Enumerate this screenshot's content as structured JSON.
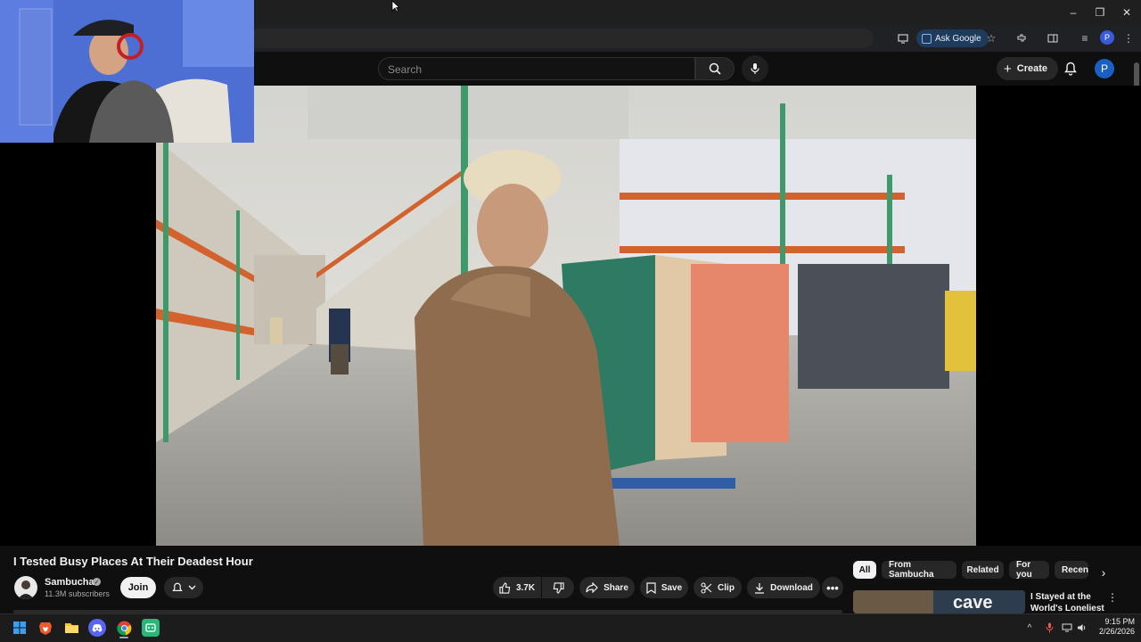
{
  "browser": {
    "ask_google_label": "Ask Google",
    "profile_initial": "P",
    "window_controls": {
      "minimize": "–",
      "restore": "❐",
      "close": "✕"
    }
  },
  "youtube": {
    "search": {
      "placeholder": "Search",
      "value": ""
    },
    "create_label": "Create",
    "avatar_initial": "P"
  },
  "video": {
    "title": "I Tested Busy Places At Their Deadest Hour",
    "channel": {
      "name": "Sambucha",
      "subscribers": "11.3M subscribers",
      "join_label": "Join"
    },
    "actions": {
      "likes": "3.7K",
      "share": "Share",
      "save": "Save",
      "clip": "Clip",
      "download": "Download"
    }
  },
  "recommendations": {
    "chips": [
      "All",
      "From Sambucha",
      "Related",
      "For you",
      "Recen"
    ],
    "first_item": {
      "title": "I Stayed at the World's Loneliest ...",
      "thumbnail_text": "cave"
    }
  },
  "taskbar": {
    "time": "9:15 PM",
    "date": "2/26/2026"
  },
  "colors": {
    "background": "#0f0f0f",
    "pill": "#272727",
    "accent_blue": "#1a5fc4"
  }
}
